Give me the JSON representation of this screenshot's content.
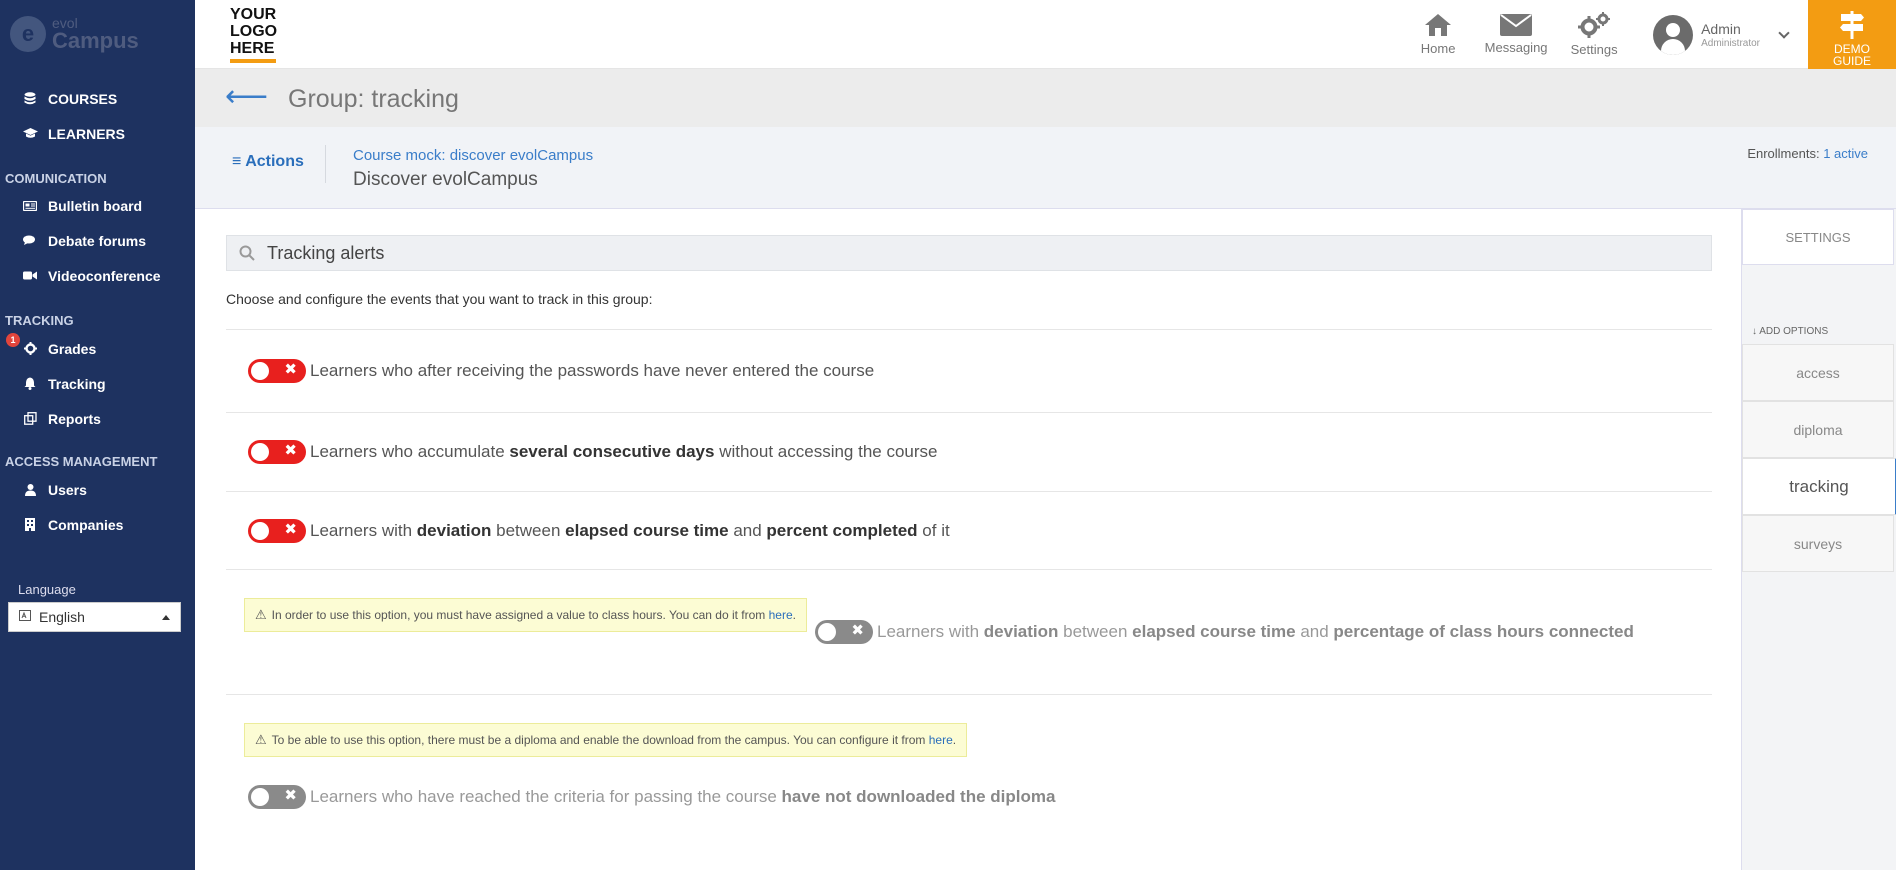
{
  "brand": {
    "line1": "evol",
    "line2": "Campus"
  },
  "sidebar": {
    "main": [
      {
        "label": "COURSES",
        "icon": "database-icon"
      },
      {
        "label": "LEARNERS",
        "icon": "graduation-cap-icon"
      }
    ],
    "communication_title": "COMUNICATION",
    "communication": [
      {
        "label": "Bulletin board",
        "icon": "newspaper-icon"
      },
      {
        "label": "Debate forums",
        "icon": "comments-icon"
      },
      {
        "label": "Videoconference",
        "icon": "video-camera-icon"
      }
    ],
    "tracking_title": "TRACKING",
    "tracking": [
      {
        "label": "Grades",
        "icon": "gear-icon",
        "badge": "1"
      },
      {
        "label": "Tracking",
        "icon": "bell-icon"
      },
      {
        "label": "Reports",
        "icon": "clone-icon"
      }
    ],
    "access_title": "ACCESS MANAGEMENT",
    "access": [
      {
        "label": "Users",
        "icon": "user-icon"
      },
      {
        "label": "Companies",
        "icon": "building-icon"
      }
    ],
    "language_label": "Language",
    "language_value": "English"
  },
  "topbar": {
    "logo": "YOUR LOGO HERE",
    "home": "Home",
    "messaging": "Messaging",
    "settings": "Settings",
    "user_name": "Admin",
    "user_role": "Administrator",
    "demo_line1": "DEMO",
    "demo_line2": "GUIDE"
  },
  "header": {
    "title": "Group: tracking"
  },
  "info": {
    "actions": "Actions",
    "course_link": "Course mock: discover evolCampus",
    "course_name": "Discover evolCampus",
    "enrollments_label": "Enrollments:",
    "enrollments_value": "1 active"
  },
  "main": {
    "search_title": "Tracking alerts",
    "intro": "Choose and configure the events that you want to track in this group:",
    "alert1": "Learners who after receiving the passwords have never entered the course",
    "alert2_a": "Learners who accumulate ",
    "alert2_b": "several consecutive days",
    "alert2_c": " without accessing the course",
    "alert3_a": "Learners with ",
    "alert3_b": "deviation",
    "alert3_c": " between ",
    "alert3_d": "elapsed course time",
    "alert3_e": " and ",
    "alert3_f": "percent completed",
    "alert3_g": " of it",
    "warn1_text": "In order to use this option, you must have assigned a value to class hours. You can do it from ",
    "warn1_link": "here",
    "alert4_a": "Learners with ",
    "alert4_b": "deviation",
    "alert4_c": " between ",
    "alert4_d": "elapsed course time",
    "alert4_e": " and ",
    "alert4_f": "percentage of class hours connected",
    "warn2_text": "To be able to use this option, there must be a diploma and enable the download from the campus. You can configure it from ",
    "warn2_link": "here",
    "alert5_a": "Learners who have reached the criteria for passing the course ",
    "alert5_b": "have not downloaded the diploma"
  },
  "right_panel": {
    "settings": "SETTINGS",
    "add_options": "ADD OPTIONS",
    "options": [
      "access",
      "diploma",
      "tracking",
      "surveys"
    ]
  },
  "colors": {
    "sidebar": "#1e3260",
    "accent": "#f39c12",
    "link": "#3a7dc9",
    "toggle_on": "#e8201e"
  }
}
